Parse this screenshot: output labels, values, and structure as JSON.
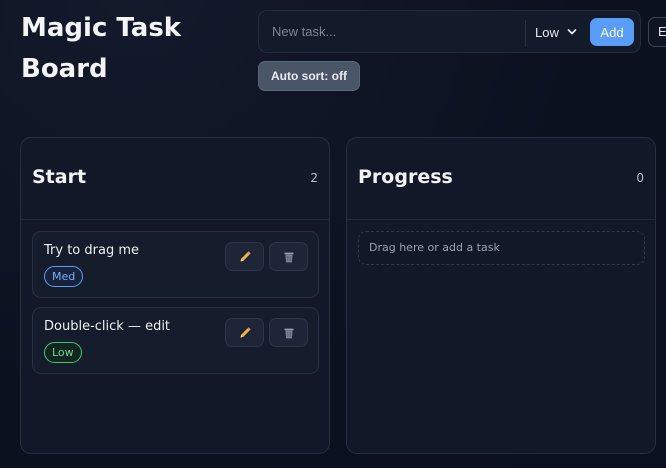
{
  "app": {
    "title": "Magic Task Board"
  },
  "toolbar": {
    "task_placeholder": "New task...",
    "priority_value": "Low",
    "add_label": "Add",
    "extra_label": "E",
    "autosort_label": "Auto sort: off"
  },
  "columns": [
    {
      "title": "Start",
      "count": "2",
      "cards": [
        {
          "text": "Try to drag me",
          "priority": "Med"
        },
        {
          "text": "Double-click — edit",
          "priority": "Low"
        }
      ]
    },
    {
      "title": "Progress",
      "count": "0",
      "empty_hint": "Drag here or add a task"
    }
  ],
  "icons": {
    "edit": "pencil-icon",
    "delete": "trash-icon",
    "dropdown": "chevron-down-icon"
  },
  "colors": {
    "accent": "#5a9df8",
    "priority_med": "#5a9df8",
    "priority_low": "#45c27a",
    "background": "#0d1220"
  }
}
